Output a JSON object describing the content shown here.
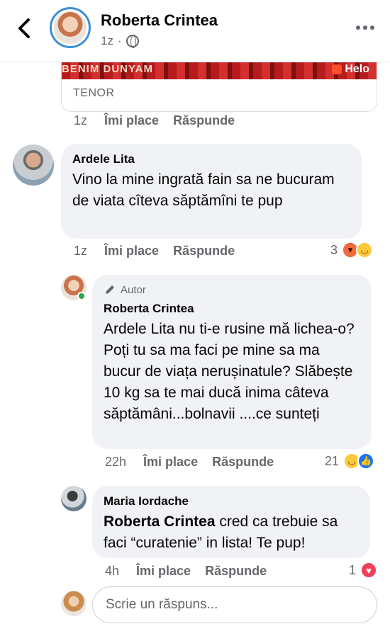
{
  "header": {
    "title": "Roberta Crintea",
    "time": "1z",
    "separator": "·"
  },
  "gif": {
    "caption_text": "BENIM DUNYAM",
    "brand": "Helo",
    "source": "TENOR"
  },
  "gif_actions": {
    "time": "1z",
    "like": "Îmi place",
    "reply": "Răspunde"
  },
  "comments": [
    {
      "author": "Ardele Lita",
      "text": "Vino la mine ingrată fain sa ne bucuram de viata cîteva săptămîni te pup",
      "time": "1z",
      "like": "Îmi place",
      "reply": "Răspunde",
      "reaction_count": "3",
      "reactions": [
        "angry-icon",
        "haha-icon"
      ]
    },
    {
      "badge": "Autor",
      "author": "Roberta Crintea",
      "text": "Ardele Lita nu ti-e rusine mă lichea-o? Poți tu sa ma faci pe mine sa ma bucur de viața nerușinatule? Slăbește 10 kg sa te mai ducă inima câteva săptămâni...bolnavii ....ce sunteți",
      "time": "22h",
      "like": "Îmi place",
      "reply": "Răspunde",
      "reaction_count": "21",
      "reactions": [
        "haha-icon",
        "like-icon"
      ]
    },
    {
      "author": "Maria Iordache",
      "mention": "Roberta Crintea",
      "text": " cred ca trebuie sa faci “curatenie” in lista! Te pup!",
      "time": "4h",
      "like": "Îmi place",
      "reply": "Răspunde",
      "reaction_count": "1",
      "reactions": [
        "love-icon"
      ]
    }
  ],
  "reply": {
    "placeholder": "Scrie un răspuns..."
  },
  "colors": {
    "accent": "#1877f2",
    "bubble": "#f0f2f5",
    "muted": "#65676b",
    "online": "#31a24c"
  }
}
